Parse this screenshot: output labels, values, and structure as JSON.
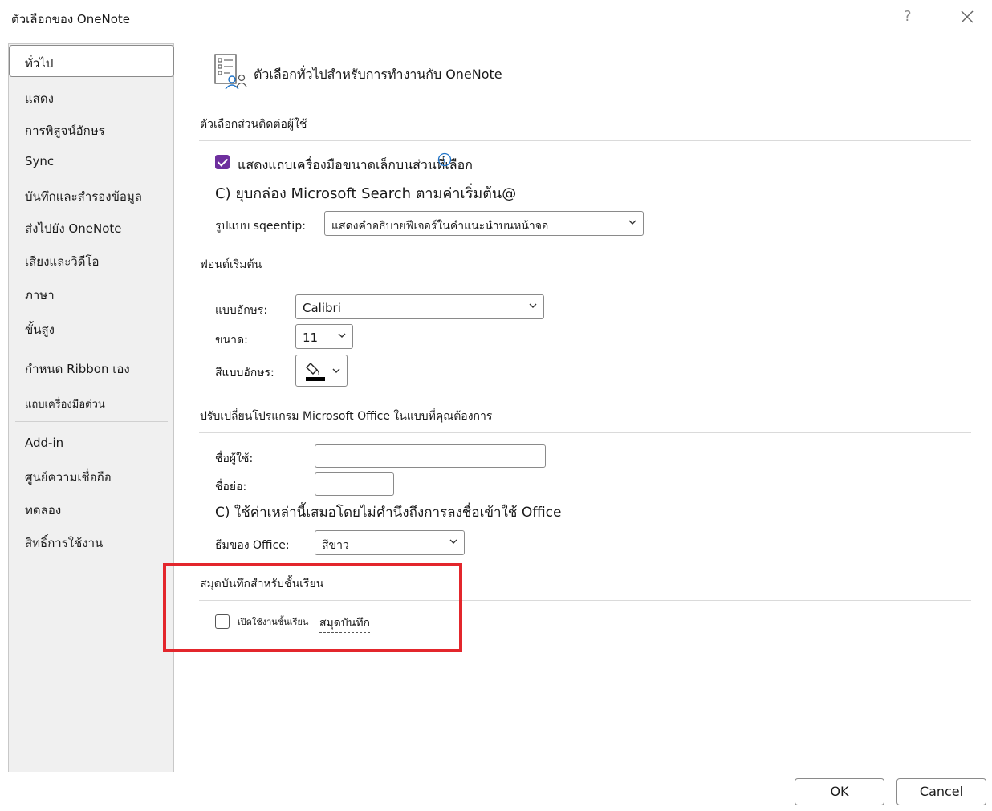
{
  "window": {
    "title": "ตัวเลือกของ OneNote",
    "help_label": "?"
  },
  "sidebar": {
    "items": [
      {
        "label": "ทั่วไป",
        "selected": true
      },
      {
        "label": "แสดง"
      },
      {
        "label": "การพิสูจน์อักษร"
      },
      {
        "label": "Sync"
      },
      {
        "label": "บันทึกและสำรองข้อมูล"
      },
      {
        "label": "ส่งไปยัง OneNote"
      },
      {
        "label": "เสียงและวิดีโอ"
      },
      {
        "label": "ภาษา"
      },
      {
        "label": "ขั้นสูง"
      },
      {
        "label": "กำหนด Ribbon เอง"
      },
      {
        "label": "แถบเครื่องมือด่วน"
      },
      {
        "label": "Add-in"
      },
      {
        "label": "ศูนย์ความเชื่อถือ"
      },
      {
        "label": "ทดลอง"
      },
      {
        "label": "สิทธิ์การใช้งาน"
      }
    ]
  },
  "main": {
    "header": "ตัวเลือกทั่วไปสำหรับการทำงานกับ OneNote",
    "ui_section": {
      "title": "ตัวเลือกส่วนติดต่อผู้ใช้",
      "mini_toolbar_label": "แสดงแถบเครื่องมือขนาดเล็กบนส่วนที่เลือก",
      "mini_toolbar_checked": true,
      "search_option_text": "C) ยุบกล่อง Microsoft Search ตามค่าเริ่มต้น@",
      "screentip_label": "รูปแบบ sqeentip:",
      "screentip_value": "แสดงคำอธิบายฟีเจอร์ในคำแนะนำบนหน้าจอ"
    },
    "font_section": {
      "title": "ฟอนต์เริ่มต้น",
      "font_label": "แบบอักษร:",
      "font_value": "Calibri",
      "size_label": "ขนาด:",
      "size_value": "11",
      "color_label": "สีแบบอักษร:"
    },
    "personalize_section": {
      "title": "ปรับเปลี่ยนโปรแกรม Microsoft  Office ในแบบที่คุณต้องการ",
      "username_label": "ชื่อผู้ใช้:",
      "username_value": "",
      "initials_label": "ชื่อย่อ:",
      "initials_value": "",
      "always_use_text": "C) ใช้ค่าเหล่านี้เสมอโดยไม่คำนึงถึงการลงชื่อเข้าใช้ Office",
      "theme_label": "ธีมของ Office:",
      "theme_value": "สีขาว"
    },
    "class_section": {
      "title": "สมุดบันทึกสำหรับชั้นเรียน",
      "enable_label": "เปิดใช้งานชั้นเรียน",
      "enable_label2": "สมุดบันทึก",
      "enable_checked": false
    }
  },
  "footer": {
    "ok_label": "OK",
    "cancel_label": "Cancel"
  },
  "colors": {
    "accent": "#6e2f9e",
    "highlight": "#e3262c"
  }
}
